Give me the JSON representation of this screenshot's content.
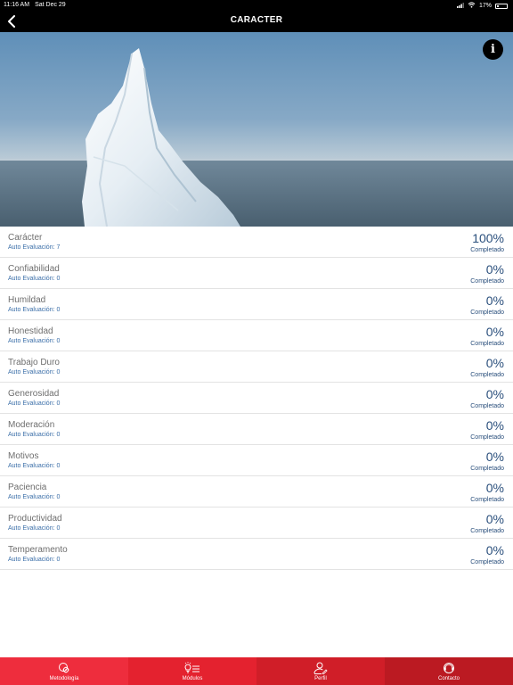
{
  "status_bar": {
    "time": "11:16 AM",
    "date": "Sat Dec 29",
    "battery": "17%"
  },
  "nav": {
    "title": "CARACTER",
    "back_icon": "chevron-left-icon"
  },
  "hero": {
    "info_label": "i"
  },
  "items": [
    {
      "title": "Carácter",
      "sub": "Auto Evaluación: 7",
      "pct": "100%",
      "status": "Completado"
    },
    {
      "title": "Confiabilidad",
      "sub": "Auto Evaluación: 0",
      "pct": "0%",
      "status": "Completado"
    },
    {
      "title": "Humildad",
      "sub": "Auto Evaluación: 0",
      "pct": "0%",
      "status": "Completado"
    },
    {
      "title": "Honestidad",
      "sub": "Auto Evaluación: 0",
      "pct": "0%",
      "status": "Completado"
    },
    {
      "title": "Trabajo Duro",
      "sub": "Auto Evaluación: 0",
      "pct": "0%",
      "status": "Completado"
    },
    {
      "title": "Generosidad",
      "sub": "Auto Evaluación: 0",
      "pct": "0%",
      "status": "Completado"
    },
    {
      "title": "Moderación",
      "sub": "Auto Evaluación: 0",
      "pct": "0%",
      "status": "Completado"
    },
    {
      "title": "Motivos",
      "sub": "Auto Evaluación: 0",
      "pct": "0%",
      "status": "Completado"
    },
    {
      "title": "Paciencia",
      "sub": "Auto Evaluación: 0",
      "pct": "0%",
      "status": "Completado"
    },
    {
      "title": "Productividad",
      "sub": "Auto Evaluación: 0",
      "pct": "0%",
      "status": "Completado"
    },
    {
      "title": "Temperamento",
      "sub": "Auto Evaluación: 0",
      "pct": "0%",
      "status": "Completado"
    }
  ],
  "tabs": [
    {
      "label": "Metodología",
      "icon": "gear-icon",
      "color": "#ee2d3d"
    },
    {
      "label": "Módulos",
      "icon": "lightbulb-list-icon",
      "color": "#e4222f"
    },
    {
      "label": "Perfil",
      "icon": "profile-icon",
      "color": "#d01e28"
    },
    {
      "label": "Contacto",
      "icon": "contact-icon",
      "color": "#bb1a22"
    }
  ]
}
